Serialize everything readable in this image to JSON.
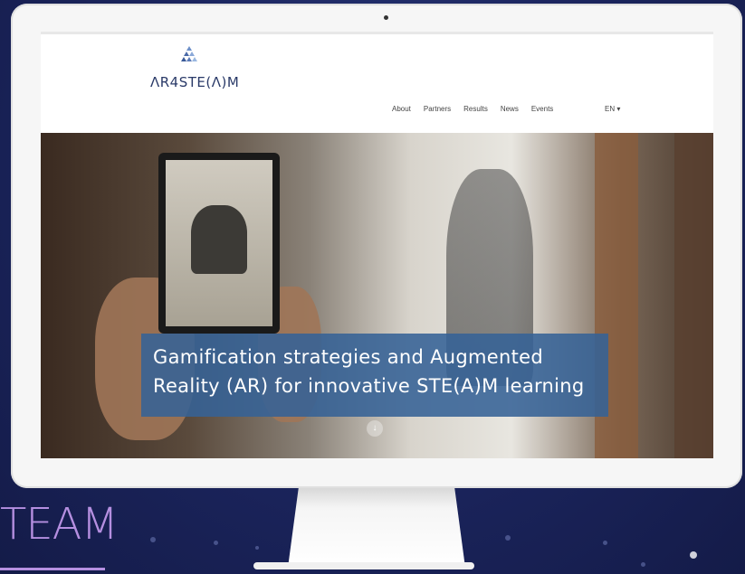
{
  "background_text": {
    "team": "TEAM"
  },
  "site": {
    "logo_text": "ΛR4STE(Λ)M",
    "logo_icon": "logo-triangles-icon",
    "nav": [
      "About",
      "Partners",
      "Results",
      "News",
      "Events"
    ],
    "language": "EN ▾",
    "hero": {
      "caption_line1": "Gamification strategies and Augmented",
      "caption_line2": "Reality (AR) for innovative STE(A)M learning",
      "scroll_icon": "arrow-down-icon",
      "scroll_symbol": "↓"
    }
  },
  "colors": {
    "accent_purple": "#b58fe0",
    "logo_navy": "#2a3a68",
    "caption_blue": "#366296"
  }
}
